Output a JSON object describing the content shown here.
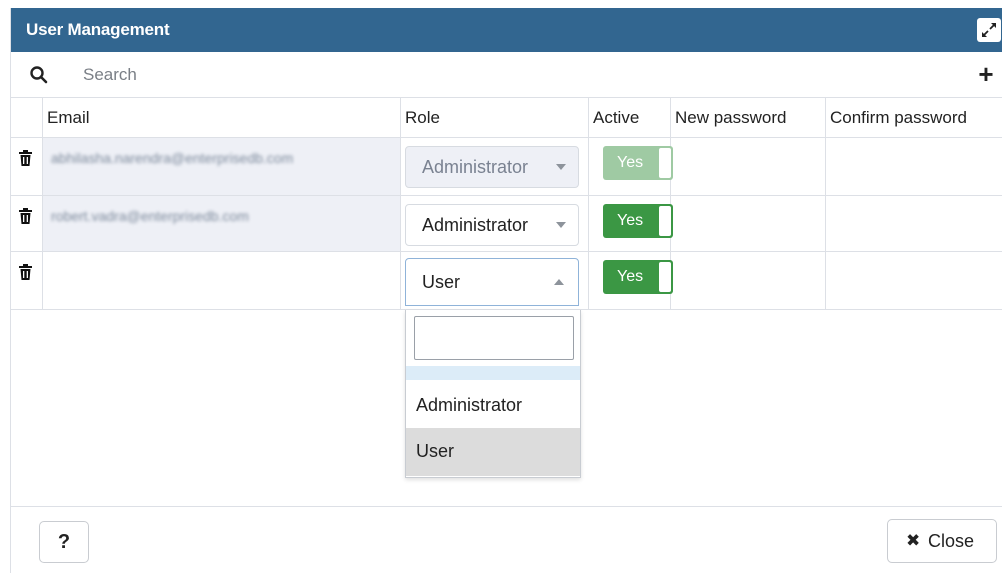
{
  "dialog": {
    "title": "User Management",
    "maximize_icon": "expand-icon"
  },
  "search": {
    "placeholder": "Search",
    "icon": "search-icon",
    "add_label": "+"
  },
  "columns": {
    "delete": "",
    "email": "Email",
    "role": "Role",
    "active": "Active",
    "new_password": "New password",
    "confirm_password": "Confirm password"
  },
  "rows": [
    {
      "email": "abhilasha.narendra@enterprisedb.com",
      "role": "Administrator",
      "active": "Yes",
      "editable": false
    },
    {
      "email": "robert.vadra@enterprisedb.com",
      "role": "Administrator",
      "active": "Yes",
      "editable": true
    },
    {
      "email": "",
      "role": "User",
      "active": "Yes",
      "editable": true
    }
  ],
  "role_dropdown": {
    "options": [
      "Administrator",
      "User"
    ],
    "selected": "User"
  },
  "footer": {
    "help_label": "?",
    "close_label": "Close",
    "close_icon": "close-icon"
  },
  "colors": {
    "titlebar": "#326690",
    "toggle_on": "#3b9744",
    "toggle_disabled": "#9fcaa3"
  }
}
